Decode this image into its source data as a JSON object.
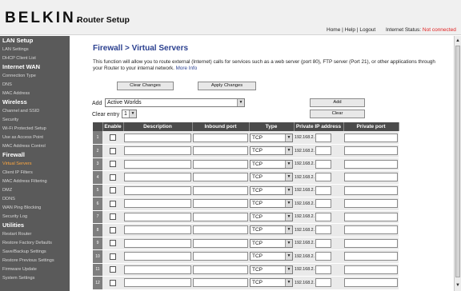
{
  "header": {
    "logo": "BELKIN.",
    "title": "Router Setup",
    "links": {
      "home": "Home",
      "help": "Help",
      "logout": "Logout",
      "sep": " | "
    },
    "status_label": "Internet Status:",
    "status_value": "Not connected"
  },
  "sidebar": {
    "lan_setup": "LAN Setup",
    "lan_settings": "LAN Settings",
    "dhcp_client_list": "DHCP Client List",
    "internet_wan": "Internet WAN",
    "connection_type": "Connection Type",
    "dns": "DNS",
    "mac_address": "MAC Address",
    "wireless": "Wireless",
    "channel_ssid": "Channel and SSID",
    "security": "Security",
    "wifi_protected_setup": "Wi-Fi Protected Setup",
    "use_as_access_point": "Use as Access Point",
    "mac_address_control": "MAC Address Control",
    "firewall": "Firewall",
    "virtual_servers": "Virtual Servers",
    "client_ip_filters": "Client IP Filters",
    "mac_address_filtering": "MAC Address Filtering",
    "dmz": "DMZ",
    "ddns": "DDNS",
    "wan_ping_blocking": "WAN Ping Blocking",
    "security_log": "Security Log",
    "utilities": "Utilities",
    "restart_router": "Restart Router",
    "restore_factory_defaults": "Restore Factory Defaults",
    "save_backup_settings": "Save/Backup Settings",
    "restore_previous_settings": "Restore Previous Settings",
    "firmware_update": "Firmware Update",
    "system_settings": "System Settings"
  },
  "main": {
    "title": "Firewall > Virtual Servers",
    "description": "This function will allow you to route external (Internet) calls for services such as a web server (port 80), FTP server (Port 21), or other applications through your Router to your internal network.",
    "more_info": "More Info",
    "clear_changes": "Clear Changes",
    "apply_changes": "Apply Changes",
    "add_label": "Add",
    "add_selected": "Active Worlds",
    "add_button": "Add",
    "clear_entry_label": "Clear entry",
    "clear_entry_selected": "1",
    "clear_button": "Clear"
  },
  "table": {
    "headers": {
      "enable": "Enable",
      "description": "Description",
      "inbound_port": "Inbound port",
      "type": "Type",
      "private_ip": "Private IP address",
      "private_port": "Private port"
    },
    "rows": [
      {
        "num": "1",
        "type": "TCP",
        "ip_prefix": "192.168.2."
      },
      {
        "num": "2",
        "type": "TCP",
        "ip_prefix": "192.168.2."
      },
      {
        "num": "3",
        "type": "TCP",
        "ip_prefix": "192.168.2."
      },
      {
        "num": "4",
        "type": "TCP",
        "ip_prefix": "192.168.2."
      },
      {
        "num": "5",
        "type": "TCP",
        "ip_prefix": "192.168.2."
      },
      {
        "num": "6",
        "type": "TCP",
        "ip_prefix": "192.168.2."
      },
      {
        "num": "7",
        "type": "TCP",
        "ip_prefix": "192.168.2."
      },
      {
        "num": "8",
        "type": "TCP",
        "ip_prefix": "192.168.2."
      },
      {
        "num": "9",
        "type": "TCP",
        "ip_prefix": "192.168.2."
      },
      {
        "num": "10",
        "type": "TCP",
        "ip_prefix": "192.168.2."
      },
      {
        "num": "11",
        "type": "TCP",
        "ip_prefix": "192.168.2."
      },
      {
        "num": "12",
        "type": "TCP",
        "ip_prefix": "192.168.2."
      }
    ]
  },
  "icons": {
    "dropdown_arrow": "chevron-down-icon",
    "scroll_up": "arrow-up-icon",
    "scroll_down": "arrow-down-icon"
  },
  "colors": {
    "title_blue": "#2a3f8f",
    "sidebar_bg": "#5a5a5a",
    "sidebar_active": "#ffa840",
    "status_red": "#e02020",
    "table_header_bg": "#4b4b4b"
  }
}
